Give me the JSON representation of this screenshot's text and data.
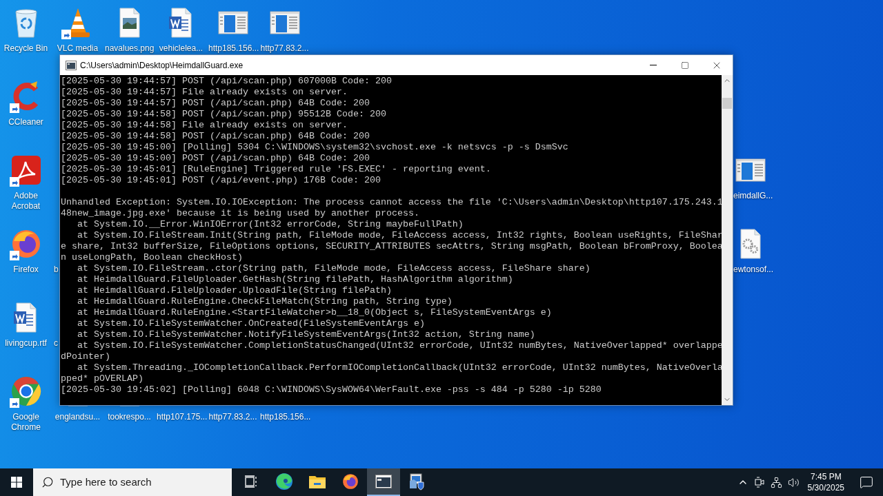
{
  "desktop": {
    "icons": [
      {
        "label": "Recycle Bin",
        "kind": "recycle",
        "shortcut": false
      },
      {
        "label": "VLC media",
        "kind": "vlc",
        "shortcut": true
      },
      {
        "label": "navalues.png",
        "kind": "image",
        "shortcut": false
      },
      {
        "label": "vehiclelea...",
        "kind": "word",
        "shortcut": false
      },
      {
        "label": "http185.156...",
        "kind": "exe",
        "shortcut": false
      },
      {
        "label": "http77.83.2...",
        "kind": "exe",
        "shortcut": false
      },
      {
        "label": "CCleaner",
        "kind": "ccleaner",
        "shortcut": true
      },
      {
        "label": "Adobe Acrobat",
        "kind": "acrobat",
        "shortcut": true
      },
      {
        "label": "eimdallG...",
        "kind": "exe",
        "shortcut": false
      },
      {
        "label": "Firefox",
        "kind": "firefox",
        "shortcut": true
      },
      {
        "label": "b",
        "kind": "hidden",
        "shortcut": false
      },
      {
        "label": "ewtonsof...",
        "kind": "gearfile",
        "shortcut": false
      },
      {
        "label": "livingcup.rtf",
        "kind": "word",
        "shortcut": false
      },
      {
        "label": "c",
        "kind": "hidden",
        "shortcut": false
      },
      {
        "label": "Google Chrome",
        "kind": "chrome",
        "shortcut": true
      },
      {
        "label": "englandsu...",
        "kind": "file",
        "shortcut": false
      },
      {
        "label": "tookrespo...",
        "kind": "file",
        "shortcut": false
      },
      {
        "label": "http107.175...",
        "kind": "hidden",
        "shortcut": false
      },
      {
        "label": "http77.83.2...",
        "kind": "hidden",
        "shortcut": false
      },
      {
        "label": "http185.156...",
        "kind": "hidden",
        "shortcut": false
      }
    ]
  },
  "window": {
    "title": "C:\\Users\\admin\\Desktop\\HeimdallGuard.exe",
    "console": {
      "blocks": [
        {
          "lines": [
            "[2025-05-30 19:44:57] POST (/api/scan.php) 607000B Code: 200",
            "[2025-05-30 19:44:57] File already exists on server.",
            "[2025-05-30 19:44:57] POST (/api/scan.php) 64B Code: 200",
            "[2025-05-30 19:44:58] POST (/api/scan.php) 95512B Code: 200",
            "[2025-05-30 19:44:58] File already exists on server.",
            "[2025-05-30 19:44:58] POST (/api/scan.php) 64B Code: 200",
            "[2025-05-30 19:45:00] [Polling] 5304 C:\\WINDOWS\\system32\\svchost.exe -k netsvcs -p -s DsmSvc",
            "[2025-05-30 19:45:00] POST (/api/scan.php) 64B Code: 200",
            "[2025-05-30 19:45:01] [RuleEngine] Triggered rule 'FS.EXEC' - reporting event.",
            "[2025-05-30 19:45:01] POST (/api/event.php) 176B Code: 200"
          ]
        },
        {
          "lines": [
            "Unhandled Exception: System.IO.IOException: The process cannot access the file 'C:\\Users\\admin\\Desktop\\http107.175.243.1",
            "48new_image.jpg.exe' because it is being used by another process.",
            "   at System.IO.__Error.WinIOError(Int32 errorCode, String maybeFullPath)",
            "   at System.IO.FileStream.Init(String path, FileMode mode, FileAccess access, Int32 rights, Boolean useRights, FileShar",
            "e share, Int32 bufferSize, FileOptions options, SECURITY_ATTRIBUTES secAttrs, String msgPath, Boolean bFromProxy, Boolea",
            "n useLongPath, Boolean checkHost)",
            "   at System.IO.FileStream..ctor(String path, FileMode mode, FileAccess access, FileShare share)",
            "   at HeimdallGuard.FileUploader.GetHash(String filePath, HashAlgorithm algorithm)",
            "   at HeimdallGuard.FileUploader.UploadFile(String filePath)",
            "   at HeimdallGuard.RuleEngine.CheckFileMatch(String path, String type)",
            "   at HeimdallGuard.RuleEngine.<StartFileWatcher>b__18_0(Object s, FileSystemEventArgs e)",
            "   at System.IO.FileSystemWatcher.OnCreated(FileSystemEventArgs e)",
            "   at System.IO.FileSystemWatcher.NotifyFileSystemEventArgs(Int32 action, String name)",
            "   at System.IO.FileSystemWatcher.CompletionStatusChanged(UInt32 errorCode, UInt32 numBytes, NativeOverlapped* overlappe",
            "dPointer)",
            "   at System.Threading._IOCompletionCallback.PerformIOCompletionCallback(UInt32 errorCode, UInt32 numBytes, NativeOverla",
            "pped* pOVERLAP)",
            "[2025-05-30 19:45:02] [Polling] 6048 C:\\WINDOWS\\SysWOW64\\WerFault.exe -pss -s 484 -p 5280 -ip 5280"
          ]
        }
      ]
    }
  },
  "taskbar": {
    "search": {
      "placeholder": "Type here to search"
    },
    "apps": [
      {
        "kind": "taskview",
        "selected": false
      },
      {
        "kind": "edge",
        "selected": false
      },
      {
        "kind": "explorer",
        "selected": false
      },
      {
        "kind": "firefox",
        "selected": false
      },
      {
        "kind": "console",
        "selected": true
      },
      {
        "kind": "setup",
        "selected": false
      }
    ],
    "clock": {
      "time": "7:45 PM",
      "date": "5/30/2025"
    }
  }
}
